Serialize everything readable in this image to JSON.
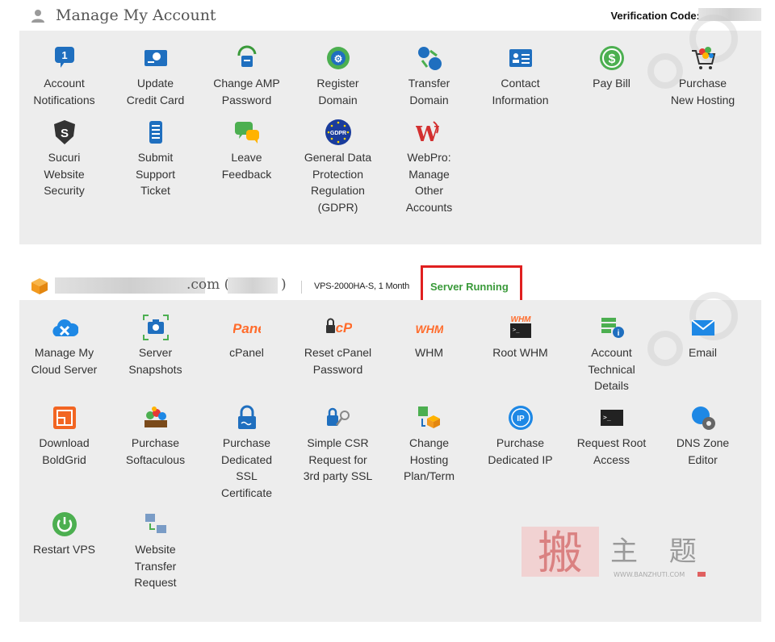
{
  "header": {
    "title": "Manage My Account",
    "verification_label": "Verification Code:"
  },
  "account_tiles": [
    {
      "label": "Account\nNotifications",
      "icon": "notification-icon"
    },
    {
      "label": "Update\nCredit Card",
      "icon": "credit-card-icon"
    },
    {
      "label": "Change AMP\nPassword",
      "icon": "password-lock-icon"
    },
    {
      "label": "Register\nDomain",
      "icon": "globe-icon"
    },
    {
      "label": "Transfer\nDomain",
      "icon": "transfer-globe-icon"
    },
    {
      "label": "Contact\nInformation",
      "icon": "contact-card-icon"
    },
    {
      "label": "Pay Bill",
      "icon": "dollar-icon"
    },
    {
      "label": "Purchase\nNew Hosting",
      "icon": "shopping-cart-icon"
    },
    {
      "label": "Sucuri\nWebsite\nSecurity",
      "icon": "shield-icon"
    },
    {
      "label": "Submit\nSupport\nTicket",
      "icon": "ticket-icon"
    },
    {
      "label": "Leave\nFeedback",
      "icon": "chat-bubbles-icon"
    },
    {
      "label": "General Data\nProtection\nRegulation\n(GDPR)",
      "icon": "gdpr-icon"
    },
    {
      "label": "WebPro:\nManage\nOther\nAccounts",
      "icon": "webpro-icon"
    }
  ],
  "server": {
    "domain_suffix": ".com (",
    "domain_close": ")",
    "plan": "VPS-2000HA-S, 1 Month",
    "status": "Server Running",
    "status_color": "#3a9a3a"
  },
  "server_tiles": [
    {
      "label": "Manage My\nCloud Server",
      "icon": "cloud-tools-icon"
    },
    {
      "label": "Server\nSnapshots",
      "icon": "camera-icon"
    },
    {
      "label": "cPanel",
      "icon": "cpanel-logo-icon",
      "logo_text": "cPanel"
    },
    {
      "label": "Reset cPanel\nPassword",
      "icon": "cpanel-lock-icon",
      "logo_text": "cP"
    },
    {
      "label": "WHM",
      "icon": "whm-logo-icon",
      "logo_text": "WHM"
    },
    {
      "label": "Root WHM",
      "icon": "whm-terminal-icon",
      "logo_text": "WHM"
    },
    {
      "label": "Account\nTechnical\nDetails",
      "icon": "server-info-icon"
    },
    {
      "label": "Email",
      "icon": "envelope-icon"
    },
    {
      "label": "Download\nBoldGrid",
      "icon": "boldgrid-icon"
    },
    {
      "label": "Purchase\nSoftaculous",
      "icon": "softaculous-icon"
    },
    {
      "label": "Purchase\nDedicated\nSSL\nCertificate",
      "icon": "ssl-lock-icon"
    },
    {
      "label": "Simple CSR\nRequest for\n3rd party SSL",
      "icon": "lock-key-icon"
    },
    {
      "label": "Change\nHosting\nPlan/Term",
      "icon": "plan-change-icon"
    },
    {
      "label": "Purchase\nDedicated IP",
      "icon": "ip-icon"
    },
    {
      "label": "Request Root\nAccess",
      "icon": "terminal-icon"
    },
    {
      "label": "DNS Zone\nEditor",
      "icon": "dns-gear-icon"
    },
    {
      "label": "Restart VPS",
      "icon": "power-icon"
    },
    {
      "label": "Website\nTransfer\nRequest",
      "icon": "website-transfer-icon"
    }
  ],
  "watermark": {
    "char_main": "搬",
    "chars": "主 题",
    "url": "WWW.BANZHUTI.COM"
  },
  "colors": {
    "panel_bg": "#ededed",
    "icon_blue": "#1f6fbf",
    "icon_green": "#4caf50",
    "cpanel_orange": "#ff6c2c",
    "highlight_red": "#e02020"
  }
}
